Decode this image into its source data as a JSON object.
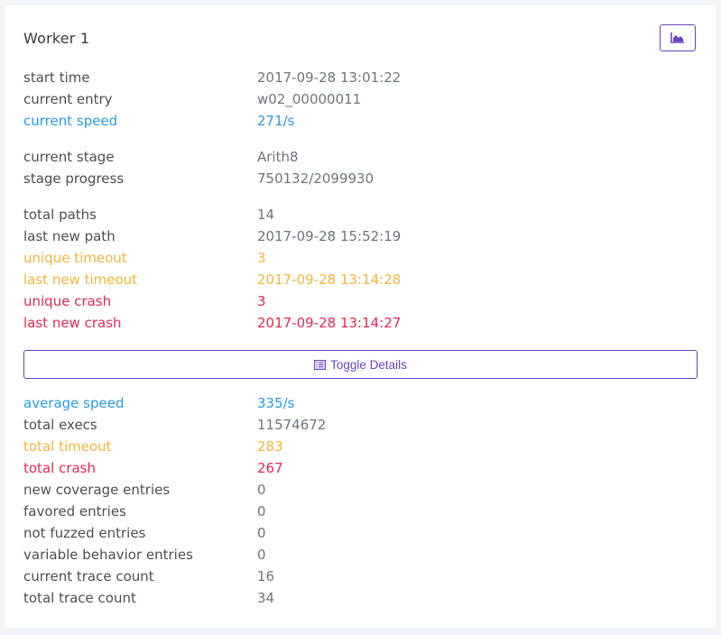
{
  "worker": {
    "title": "Worker 1",
    "chart_button_icon": "area-chart-icon"
  },
  "section1": [
    {
      "label": "start time",
      "value": "2017-09-28 13:01:22",
      "tone": "default"
    },
    {
      "label": "current entry",
      "value": "w02_00000011",
      "tone": "default"
    },
    {
      "label": "current speed",
      "value": "271/s",
      "tone": "blue"
    }
  ],
  "section2": [
    {
      "label": "current stage",
      "value": "Arith8",
      "tone": "default"
    },
    {
      "label": "stage progress",
      "value": "750132/2099930",
      "tone": "default"
    }
  ],
  "section3": [
    {
      "label": "total paths",
      "value": "14",
      "tone": "default"
    },
    {
      "label": "last new path",
      "value": "2017-09-28 15:52:19",
      "tone": "default"
    },
    {
      "label": "unique timeout",
      "value": "3",
      "tone": "orange"
    },
    {
      "label": "last new timeout",
      "value": "2017-09-28 13:14:28",
      "tone": "orange"
    },
    {
      "label": "unique crash",
      "value": "3",
      "tone": "red"
    },
    {
      "label": "last new crash",
      "value": "2017-09-28 13:14:27",
      "tone": "red"
    }
  ],
  "toggle": {
    "label": "Toggle Details",
    "icon": "list-alt-icon"
  },
  "details": [
    {
      "label": "average speed",
      "value": "335/s",
      "tone": "blue"
    },
    {
      "label": "total execs",
      "value": "11574672",
      "tone": "default"
    },
    {
      "label": "total timeout",
      "value": "283",
      "tone": "orange"
    },
    {
      "label": "total crash",
      "value": "267",
      "tone": "red"
    },
    {
      "label": "new coverage entries",
      "value": "0",
      "tone": "default"
    },
    {
      "label": "favored entries",
      "value": "0",
      "tone": "default"
    },
    {
      "label": "not fuzzed entries",
      "value": "0",
      "tone": "default"
    },
    {
      "label": "variable behavior entries",
      "value": "0",
      "tone": "default"
    },
    {
      "label": "current trace count",
      "value": "16",
      "tone": "default"
    },
    {
      "label": "total trace count",
      "value": "34",
      "tone": "default"
    }
  ],
  "colors": {
    "accent": "#6f42c1",
    "blue": "#2a9ae4",
    "orange": "#f4b43a",
    "red": "#e8284e",
    "text": "#4a4f55"
  }
}
